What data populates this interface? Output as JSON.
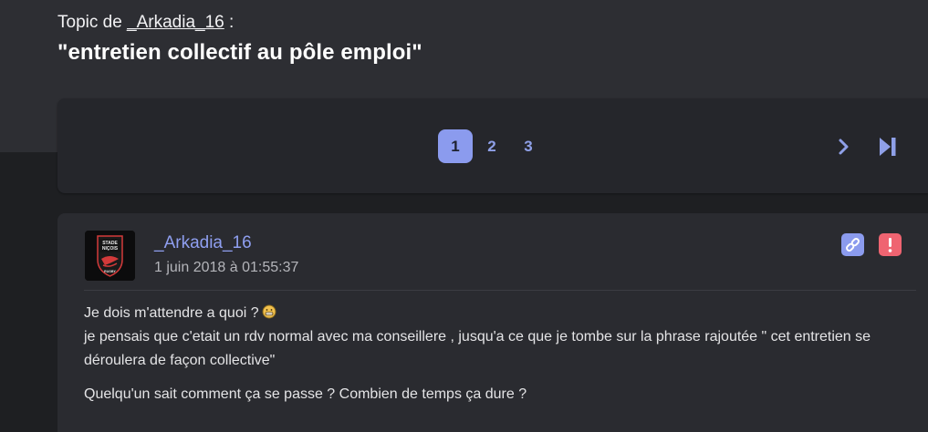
{
  "topic": {
    "prefix": "Topic de ",
    "author": "_Arkadia_16",
    "suffix": " :",
    "title": "\"entretien collectif au pôle emploi\""
  },
  "pagination": {
    "pages": [
      "1",
      "2",
      "3"
    ],
    "current": "1",
    "next_icon": "chevron-right-icon",
    "last_icon": "skip-to-last-icon",
    "accent": "#8b9bee"
  },
  "post": {
    "author": "_Arkadia_16",
    "date": "1 juin 2018 à 01:55:37",
    "avatar": {
      "icon": "stade-nicois-rugby-logo",
      "text": [
        "STADE",
        "NIÇOIS",
        "RUGBY"
      ]
    },
    "actions": {
      "link_icon": "link-icon",
      "report_icon": "exclamation-icon",
      "link_color": "#8b9bee",
      "report_color": "#ef6471"
    },
    "lines": [
      "Je dois m'attendre a quoi ?",
      "je pensais que c'etait un rdv normal avec ma conseillere , jusqu'a ce que je tombe sur la phrase rajoutée \" cet entretien se déroulera de façon collective\"",
      "Quelqu'un sait comment ça se passe ? Combien de temps ça dure ?"
    ],
    "emoji": "smiley-icon"
  }
}
